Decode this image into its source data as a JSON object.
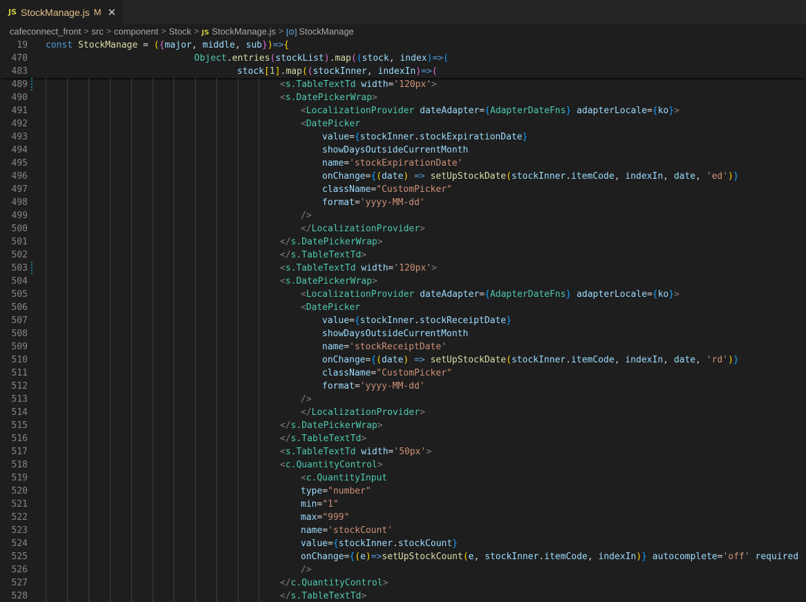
{
  "tab": {
    "lang_badge": "JS",
    "title": "StockManage.js",
    "modified": "M",
    "close": "✕"
  },
  "breadcrumb": [
    {
      "label": "cafeconnect_front"
    },
    {
      "label": "src"
    },
    {
      "label": "component"
    },
    {
      "label": "Stock"
    },
    {
      "label": "StockManage.js",
      "badge": "JS"
    },
    {
      "label": "StockManage",
      "symbol": "[⊙]"
    }
  ],
  "colors": {
    "keyword": "#569cd6",
    "variable": "#9cdcfe",
    "function": "#dcdcaa",
    "type": "#4ec9b0",
    "string": "#ce9178",
    "tag_bracket": "#808080",
    "operator": "#d4d4d4",
    "brace1": "#ffd700",
    "brace2": "#da70d6",
    "brace3": "#179fff",
    "number": "#b5cea8"
  },
  "sticky_lines": [
    {
      "num": "19",
      "indent": 0,
      "tokens": [
        [
          "const ",
          "keyword"
        ],
        [
          "StockManage",
          "function"
        ],
        [
          " = ",
          "operator"
        ],
        [
          "(",
          "brace1"
        ],
        [
          "{",
          "brace2"
        ],
        [
          "major",
          "variable"
        ],
        [
          ", ",
          "operator"
        ],
        [
          "middle",
          "variable"
        ],
        [
          ", ",
          "operator"
        ],
        [
          "sub",
          "variable"
        ],
        [
          "}",
          "brace2"
        ],
        [
          ")",
          "brace1"
        ],
        [
          "=>",
          "keyword"
        ],
        [
          "{",
          "brace1"
        ]
      ]
    },
    {
      "num": "470",
      "indent": 215,
      "tokens": [
        [
          "Object",
          "type"
        ],
        [
          ".",
          "operator"
        ],
        [
          "entries",
          "function"
        ],
        [
          "(",
          "brace2"
        ],
        [
          "stockList",
          "variable"
        ],
        [
          ")",
          "brace2"
        ],
        [
          ".",
          "operator"
        ],
        [
          "map",
          "function"
        ],
        [
          "(",
          "brace2"
        ],
        [
          "(",
          "brace3"
        ],
        [
          "stock",
          "variable"
        ],
        [
          ", ",
          "operator"
        ],
        [
          "index",
          "variable"
        ],
        [
          ")",
          "brace3"
        ],
        [
          "=>",
          "keyword"
        ],
        [
          "(",
          "brace3"
        ]
      ]
    },
    {
      "num": "483",
      "indent": 277,
      "tokens": [
        [
          "stock",
          "variable"
        ],
        [
          "[",
          "brace1"
        ],
        [
          "1",
          "number"
        ],
        [
          "]",
          "brace1"
        ],
        [
          ".",
          "operator"
        ],
        [
          "map",
          "function"
        ],
        [
          "(",
          "brace1"
        ],
        [
          "(",
          "brace2"
        ],
        [
          "stockInner",
          "variable"
        ],
        [
          ", ",
          "operator"
        ],
        [
          "indexIn",
          "variable"
        ],
        [
          ")",
          "brace2"
        ],
        [
          "=>",
          "keyword"
        ],
        [
          "(",
          "brace2"
        ]
      ]
    }
  ],
  "lines": [
    {
      "num": "489",
      "indent": 339,
      "mod": true,
      "tokens": [
        [
          "<",
          "tag_bracket"
        ],
        [
          "s.TableTextTd",
          "type"
        ],
        [
          " width",
          "variable"
        ],
        [
          "=",
          "operator"
        ],
        [
          "'120px'",
          "string"
        ],
        [
          ">",
          "tag_bracket"
        ]
      ]
    },
    {
      "num": "490",
      "indent": 339,
      "tokens": [
        [
          "<",
          "tag_bracket"
        ],
        [
          "s.DatePickerWrap",
          "type"
        ],
        [
          ">",
          "tag_bracket"
        ]
      ]
    },
    {
      "num": "491",
      "indent": 369,
      "tokens": [
        [
          "<",
          "tag_bracket"
        ],
        [
          "LocalizationProvider",
          "type"
        ],
        [
          " dateAdapter",
          "variable"
        ],
        [
          "=",
          "operator"
        ],
        [
          "{",
          "brace3"
        ],
        [
          "AdapterDateFns",
          "type"
        ],
        [
          "}",
          "brace3"
        ],
        [
          " adapterLocale",
          "variable"
        ],
        [
          "=",
          "operator"
        ],
        [
          "{",
          "brace3"
        ],
        [
          "ko",
          "variable"
        ],
        [
          "}",
          "brace3"
        ],
        [
          ">",
          "tag_bracket"
        ]
      ]
    },
    {
      "num": "492",
      "indent": 369,
      "tokens": [
        [
          "<",
          "tag_bracket"
        ],
        [
          "DatePicker",
          "type"
        ]
      ]
    },
    {
      "num": "493",
      "indent": 400,
      "tokens": [
        [
          "value",
          "variable"
        ],
        [
          "=",
          "operator"
        ],
        [
          "{",
          "brace3"
        ],
        [
          "stockInner",
          "variable"
        ],
        [
          ".",
          "operator"
        ],
        [
          "stockExpirationDate",
          "variable"
        ],
        [
          "}",
          "brace3"
        ]
      ]
    },
    {
      "num": "494",
      "indent": 400,
      "tokens": [
        [
          "showDaysOutsideCurrentMonth",
          "variable"
        ]
      ]
    },
    {
      "num": "495",
      "indent": 400,
      "tokens": [
        [
          "name",
          "variable"
        ],
        [
          "=",
          "operator"
        ],
        [
          "'stockExpirationDate'",
          "string"
        ]
      ]
    },
    {
      "num": "496",
      "indent": 400,
      "tokens": [
        [
          "onChange",
          "variable"
        ],
        [
          "=",
          "operator"
        ],
        [
          "{",
          "brace3"
        ],
        [
          "(",
          "brace1"
        ],
        [
          "date",
          "variable"
        ],
        [
          ")",
          "brace1"
        ],
        [
          " => ",
          "keyword"
        ],
        [
          "setUpStockDate",
          "function"
        ],
        [
          "(",
          "brace1"
        ],
        [
          "stockInner",
          "variable"
        ],
        [
          ".",
          "operator"
        ],
        [
          "itemCode",
          "variable"
        ],
        [
          ", ",
          "operator"
        ],
        [
          "indexIn",
          "variable"
        ],
        [
          ", ",
          "operator"
        ],
        [
          "date",
          "variable"
        ],
        [
          ", ",
          "operator"
        ],
        [
          "'ed'",
          "string"
        ],
        [
          ")",
          "brace1"
        ],
        [
          "}",
          "brace3"
        ]
      ]
    },
    {
      "num": "497",
      "indent": 400,
      "tokens": [
        [
          "className",
          "variable"
        ],
        [
          "=",
          "operator"
        ],
        [
          "\"CustomPicker\"",
          "string"
        ]
      ]
    },
    {
      "num": "498",
      "indent": 400,
      "tokens": [
        [
          "format",
          "variable"
        ],
        [
          "=",
          "operator"
        ],
        [
          "'yyyy-MM-dd'",
          "string"
        ]
      ]
    },
    {
      "num": "499",
      "indent": 369,
      "tokens": [
        [
          "/>",
          "tag_bracket"
        ]
      ]
    },
    {
      "num": "500",
      "indent": 369,
      "tokens": [
        [
          "</",
          "tag_bracket"
        ],
        [
          "LocalizationProvider",
          "type"
        ],
        [
          ">",
          "tag_bracket"
        ]
      ]
    },
    {
      "num": "501",
      "indent": 339,
      "tokens": [
        [
          "</",
          "tag_bracket"
        ],
        [
          "s.DatePickerWrap",
          "type"
        ],
        [
          ">",
          "tag_bracket"
        ]
      ]
    },
    {
      "num": "502",
      "indent": 339,
      "tokens": [
        [
          "</",
          "tag_bracket"
        ],
        [
          "s.TableTextTd",
          "type"
        ],
        [
          ">",
          "tag_bracket"
        ]
      ]
    },
    {
      "num": "503",
      "indent": 339,
      "mod": true,
      "tokens": [
        [
          "<",
          "tag_bracket"
        ],
        [
          "s.TableTextTd",
          "type"
        ],
        [
          " width",
          "variable"
        ],
        [
          "=",
          "operator"
        ],
        [
          "'120px'",
          "string"
        ],
        [
          ">",
          "tag_bracket"
        ]
      ]
    },
    {
      "num": "504",
      "indent": 339,
      "tokens": [
        [
          "<",
          "tag_bracket"
        ],
        [
          "s.DatePickerWrap",
          "type"
        ],
        [
          ">",
          "tag_bracket"
        ]
      ]
    },
    {
      "num": "505",
      "indent": 369,
      "tokens": [
        [
          "<",
          "tag_bracket"
        ],
        [
          "LocalizationProvider",
          "type"
        ],
        [
          " dateAdapter",
          "variable"
        ],
        [
          "=",
          "operator"
        ],
        [
          "{",
          "brace3"
        ],
        [
          "AdapterDateFns",
          "type"
        ],
        [
          "}",
          "brace3"
        ],
        [
          " adapterLocale",
          "variable"
        ],
        [
          "=",
          "operator"
        ],
        [
          "{",
          "brace3"
        ],
        [
          "ko",
          "variable"
        ],
        [
          "}",
          "brace3"
        ],
        [
          ">",
          "tag_bracket"
        ]
      ]
    },
    {
      "num": "506",
      "indent": 369,
      "tokens": [
        [
          "<",
          "tag_bracket"
        ],
        [
          "DatePicker",
          "type"
        ]
      ]
    },
    {
      "num": "507",
      "indent": 400,
      "tokens": [
        [
          "value",
          "variable"
        ],
        [
          "=",
          "operator"
        ],
        [
          "{",
          "brace3"
        ],
        [
          "stockInner",
          "variable"
        ],
        [
          ".",
          "operator"
        ],
        [
          "stockReceiptDate",
          "variable"
        ],
        [
          "}",
          "brace3"
        ]
      ]
    },
    {
      "num": "508",
      "indent": 400,
      "tokens": [
        [
          "showDaysOutsideCurrentMonth",
          "variable"
        ]
      ]
    },
    {
      "num": "509",
      "indent": 400,
      "tokens": [
        [
          "name",
          "variable"
        ],
        [
          "=",
          "operator"
        ],
        [
          "'stockReceiptDate'",
          "string"
        ]
      ]
    },
    {
      "num": "510",
      "indent": 400,
      "tokens": [
        [
          "onChange",
          "variable"
        ],
        [
          "=",
          "operator"
        ],
        [
          "{",
          "brace3"
        ],
        [
          "(",
          "brace1"
        ],
        [
          "date",
          "variable"
        ],
        [
          ")",
          "brace1"
        ],
        [
          " => ",
          "keyword"
        ],
        [
          "setUpStockDate",
          "function"
        ],
        [
          "(",
          "brace1"
        ],
        [
          "stockInner",
          "variable"
        ],
        [
          ".",
          "operator"
        ],
        [
          "itemCode",
          "variable"
        ],
        [
          ", ",
          "operator"
        ],
        [
          "indexIn",
          "variable"
        ],
        [
          ", ",
          "operator"
        ],
        [
          "date",
          "variable"
        ],
        [
          ", ",
          "operator"
        ],
        [
          "'rd'",
          "string"
        ],
        [
          ")",
          "brace1"
        ],
        [
          "}",
          "brace3"
        ]
      ]
    },
    {
      "num": "511",
      "indent": 400,
      "tokens": [
        [
          "className",
          "variable"
        ],
        [
          "=",
          "operator"
        ],
        [
          "\"CustomPicker\"",
          "string"
        ]
      ]
    },
    {
      "num": "512",
      "indent": 400,
      "tokens": [
        [
          "format",
          "variable"
        ],
        [
          "=",
          "operator"
        ],
        [
          "'yyyy-MM-dd'",
          "string"
        ]
      ]
    },
    {
      "num": "513",
      "indent": 369,
      "tokens": [
        [
          "/>",
          "tag_bracket"
        ]
      ]
    },
    {
      "num": "514",
      "indent": 369,
      "tokens": [
        [
          "</",
          "tag_bracket"
        ],
        [
          "LocalizationProvider",
          "type"
        ],
        [
          ">",
          "tag_bracket"
        ]
      ]
    },
    {
      "num": "515",
      "indent": 339,
      "tokens": [
        [
          "</",
          "tag_bracket"
        ],
        [
          "s.DatePickerWrap",
          "type"
        ],
        [
          ">",
          "tag_bracket"
        ]
      ]
    },
    {
      "num": "516",
      "indent": 339,
      "tokens": [
        [
          "</",
          "tag_bracket"
        ],
        [
          "s.TableTextTd",
          "type"
        ],
        [
          ">",
          "tag_bracket"
        ]
      ]
    },
    {
      "num": "517",
      "indent": 339,
      "tokens": [
        [
          "<",
          "tag_bracket"
        ],
        [
          "s.TableTextTd",
          "type"
        ],
        [
          " width",
          "variable"
        ],
        [
          "=",
          "operator"
        ],
        [
          "'50px'",
          "string"
        ],
        [
          ">",
          "tag_bracket"
        ]
      ]
    },
    {
      "num": "518",
      "indent": 339,
      "tokens": [
        [
          "<",
          "tag_bracket"
        ],
        [
          "c.QuantityControl",
          "type"
        ],
        [
          ">",
          "tag_bracket"
        ]
      ]
    },
    {
      "num": "519",
      "indent": 369,
      "tokens": [
        [
          "<",
          "tag_bracket"
        ],
        [
          "c.QuantityInput",
          "type"
        ]
      ]
    },
    {
      "num": "520",
      "indent": 369,
      "tokens": [
        [
          "type",
          "variable"
        ],
        [
          "=",
          "operator"
        ],
        [
          "\"number\"",
          "string"
        ]
      ]
    },
    {
      "num": "521",
      "indent": 369,
      "tokens": [
        [
          "min",
          "variable"
        ],
        [
          "=",
          "operator"
        ],
        [
          "\"1\"",
          "string"
        ]
      ]
    },
    {
      "num": "522",
      "indent": 369,
      "tokens": [
        [
          "max",
          "variable"
        ],
        [
          "=",
          "operator"
        ],
        [
          "\"999\"",
          "string"
        ]
      ]
    },
    {
      "num": "523",
      "indent": 369,
      "tokens": [
        [
          "name",
          "variable"
        ],
        [
          "=",
          "operator"
        ],
        [
          "'stockCount'",
          "string"
        ]
      ]
    },
    {
      "num": "524",
      "indent": 369,
      "tokens": [
        [
          "value",
          "variable"
        ],
        [
          "=",
          "operator"
        ],
        [
          "{",
          "brace3"
        ],
        [
          "stockInner",
          "variable"
        ],
        [
          ".",
          "operator"
        ],
        [
          "stockCount",
          "variable"
        ],
        [
          "}",
          "brace3"
        ]
      ]
    },
    {
      "num": "525",
      "indent": 369,
      "tokens": [
        [
          "onChange",
          "variable"
        ],
        [
          "=",
          "operator"
        ],
        [
          "{",
          "brace3"
        ],
        [
          "(",
          "brace1"
        ],
        [
          "e",
          "variable"
        ],
        [
          ")",
          "brace1"
        ],
        [
          "=>",
          "keyword"
        ],
        [
          "setUpStockCount",
          "function"
        ],
        [
          "(",
          "brace1"
        ],
        [
          "e",
          "variable"
        ],
        [
          ", ",
          "operator"
        ],
        [
          "stockInner",
          "variable"
        ],
        [
          ".",
          "operator"
        ],
        [
          "itemCode",
          "variable"
        ],
        [
          ", ",
          "operator"
        ],
        [
          "indexIn",
          "variable"
        ],
        [
          ")",
          "brace1"
        ],
        [
          "}",
          "brace3"
        ],
        [
          " autocomplete",
          "variable"
        ],
        [
          "=",
          "operator"
        ],
        [
          "'off'",
          "string"
        ],
        [
          " required",
          "variable"
        ]
      ]
    },
    {
      "num": "526",
      "indent": 369,
      "tokens": [
        [
          "/>",
          "tag_bracket"
        ]
      ]
    },
    {
      "num": "527",
      "indent": 339,
      "tokens": [
        [
          "</",
          "tag_bracket"
        ],
        [
          "c.QuantityControl",
          "type"
        ],
        [
          ">",
          "tag_bracket"
        ]
      ]
    },
    {
      "num": "528",
      "indent": 339,
      "tokens": [
        [
          "</",
          "tag_bracket"
        ],
        [
          "s.TableTextTd",
          "type"
        ],
        [
          ">",
          "tag_bracket"
        ]
      ]
    }
  ]
}
